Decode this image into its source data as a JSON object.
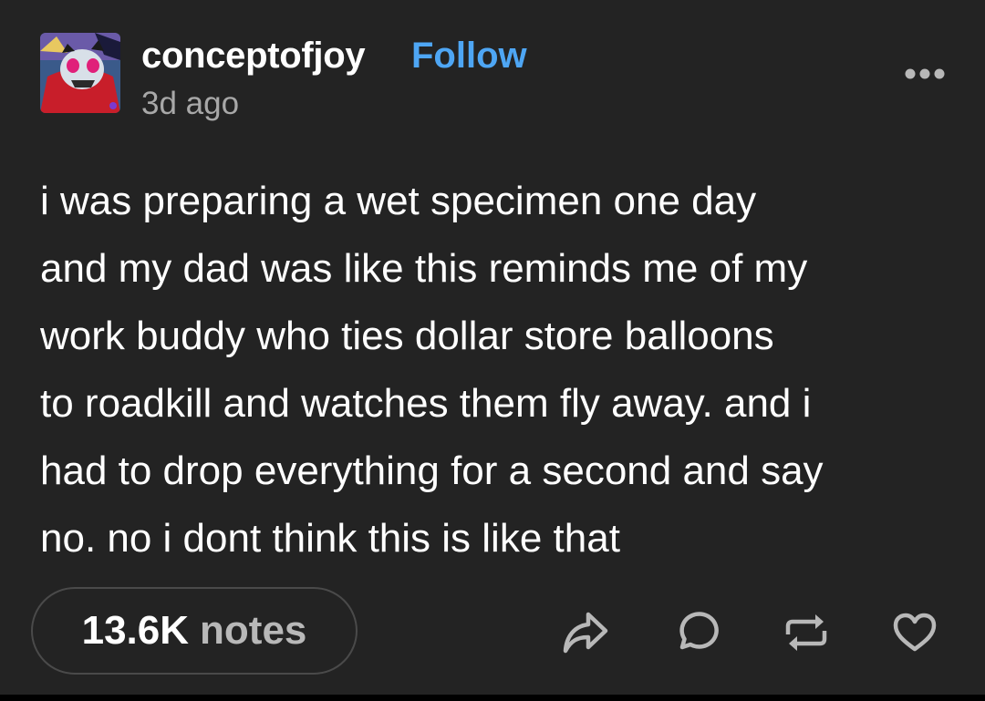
{
  "post": {
    "author": {
      "username": "conceptofjoy",
      "follow_label": "Follow",
      "timestamp": "3d ago"
    },
    "body": "i was preparing a wet specimen one day\nand my dad was like this reminds me of my\nwork buddy who ties dollar store balloons\nto roadkill and watches them fly away. and i\nhad to drop everything for a second and say\nno. no i dont think this is like that",
    "notes": {
      "count": "13.6K",
      "label": "notes"
    },
    "actions": [
      "share-icon",
      "reply-icon",
      "reblog-icon",
      "like-icon"
    ],
    "menu_icon": "more-options-icon"
  },
  "colors": {
    "background": "#232323",
    "text": "#ffffff",
    "follow": "#4ea6f4",
    "muted": "#a8a8a8"
  }
}
